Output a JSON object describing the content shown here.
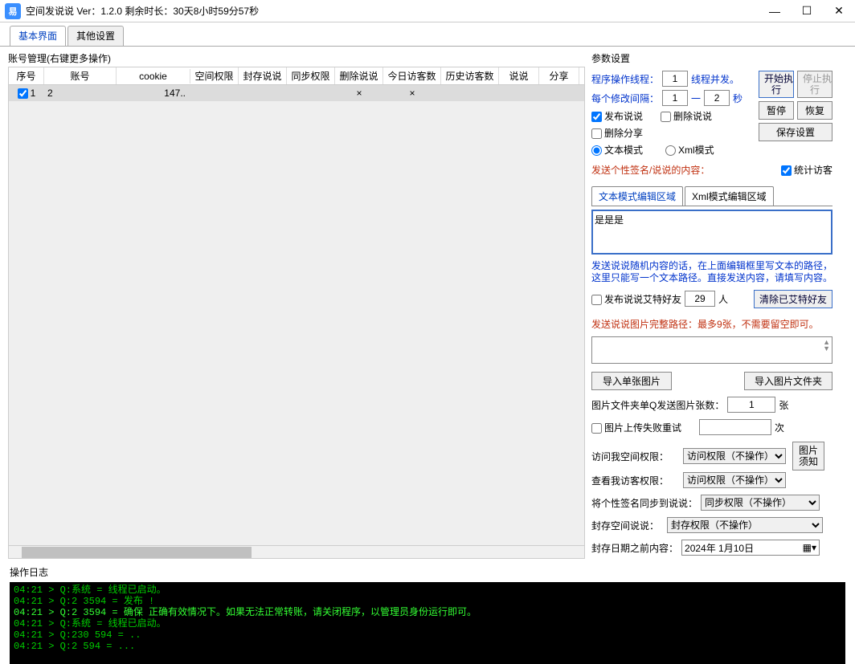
{
  "titlebar": {
    "app_icon": "易",
    "title": "空间发说说   Ver：1.2.0   剩余时长：30天8小时59分57秒"
  },
  "tabs": {
    "basic": "基本界面",
    "other": "其他设置"
  },
  "account": {
    "header": "账号管理(右键更多操作)",
    "cols": [
      "序号",
      "账号",
      "cookie",
      "空间权限",
      "封存说说",
      "同步权限",
      "删除说说",
      "今日访客数",
      "历史访客数",
      "说说",
      "分享"
    ],
    "row": {
      "idx": "1",
      "acct": "2",
      "cookie": "147..",
      "del": "×",
      "today": "×"
    }
  },
  "params": {
    "title": "参数设置",
    "thread_label": "程序操作线程：",
    "thread_val": "1",
    "thread_mode": "线程并发。",
    "start": "开始执\n行",
    "stop": "停止执\n行",
    "interval_label": "每个修改间隔：",
    "interval_min": "1",
    "interval_dash": "一",
    "interval_max": "2",
    "interval_unit": "秒",
    "pause": "暂停",
    "resume": "恢复",
    "cb_publish": "发布说说",
    "cb_delete": "删除说说",
    "save": "保存设置",
    "cb_delshare": "删除分享",
    "radio_text": "文本模式",
    "radio_xml": "Xml模式",
    "send_label": "发送个性签名/说说的内容：",
    "cb_stat": "统计访客",
    "tab_text": "文本模式编辑区域",
    "tab_xml": "Xml模式编辑区域",
    "content": "是是是",
    "note_random": "发送说说随机内容的话，在上面编辑框里写文本的路径，这里只能写一个文本路径。直接发送内容，请填写内容。",
    "cb_at": "发布说说艾特好友",
    "at_count": "29",
    "at_unit": "人",
    "clear_at": "清除已艾特好友",
    "note_img": "发送说说图片完整路径：最多9张，不需要留空即可。",
    "import_single": "导入单张图片",
    "import_folder": "导入图片文件夹",
    "folder_label": "图片文件夹单Q发送图片张数：",
    "folder_count": "1",
    "folder_unit": "张",
    "cb_retry": "图片上传失败重试",
    "retry_unit": "次",
    "visit_me_label": "访问我空间权限：",
    "visit_me_val": "访问权限（不操作）",
    "img_note_btn": "图片\n须知",
    "view_me_label": "查看我访客权限：",
    "view_me_val": "访问权限（不操作）",
    "sync_label": "将个性签名同步到说说：",
    "sync_val": "同步权限（不操作）",
    "seal_label": "封存空间说说：",
    "seal_val": "封存权限（不操作）",
    "seal_date_label": "封存日期之前内容：",
    "seal_date": "2024年 1月10日"
  },
  "log": {
    "label": "操作日志",
    "lines": [
      "04:21 > Q:系统 =  线程已启动。",
      "04:21 > Q:2      3594 =  发布         !",
      "04:21 > Q:2      3594 = 确保    正确有效情况下。如果无法正常转账，请关闭程序，以管理员身份运行即可。",
      "04:21 > Q:系统 =  线程已启动。",
      "04:21 > Q:230    594 = ..",
      "04:21 > Q:2      594 = ..."
    ]
  }
}
